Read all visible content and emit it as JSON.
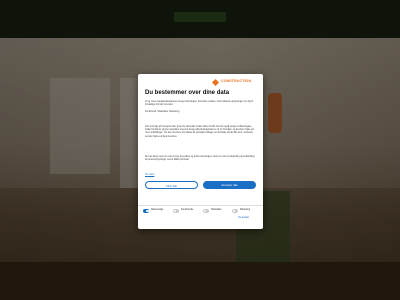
{
  "colors": {
    "accent": "#1a6fc4",
    "brand": "#e8711e",
    "header": "#1b2414"
  },
  "consent": {
    "logo_name": "CONSTRUCTION",
    "logo_tag": "",
    "title": "Du bestemmer over dine data",
    "intro": "Vi og vores samarbejdspartnere bruger teknologier, herunder cookies, til at indsamle oplysninger om dig til forskellige formål, herunder:",
    "purposes": "Funktionelt, Statistiske, Marketing",
    "detail": "Ved at trykke på 'Accepter alle' giver du samtykke til alle disse formål. Du kan også vælge at tilkendegive, hvilke formål du vil give samtykke til ved at bruge afkrydsningsfelterne ud for formålet, og derefter trykke på 'Gem indstillinger'. Du kan til enhver tid trække dit samtykke tilbage ved at klikke på det lille ikon i nederste venstre hjørne af hjemmesiden.",
    "more": "Du kan læse mere om vores brug af cookies og andre teknologier, samt om vores indsamling og behandling af personoplysninger ved at klikke på linket.",
    "read_more": "Vis mere",
    "deny_label": "Afvis alle",
    "accept_label": "Accepter alle",
    "toggles": [
      {
        "label": "Nødvendige",
        "on": true
      },
      {
        "label": "Funktionelle",
        "on": false
      },
      {
        "label": "Statistiske",
        "on": false
      },
      {
        "label": "Marketing",
        "on": false
      }
    ],
    "details_label": "Vis detaljer"
  }
}
